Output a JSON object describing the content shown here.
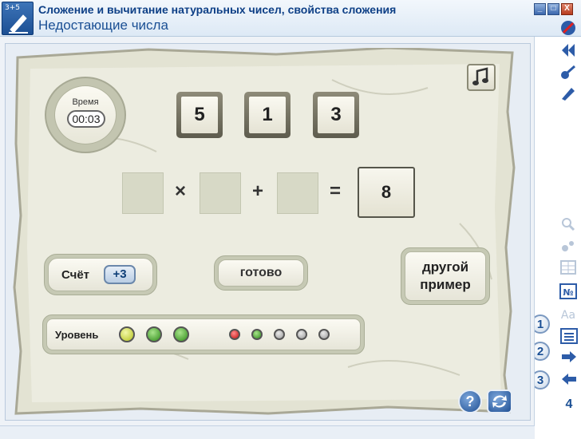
{
  "header": {
    "logo_label": "3+5",
    "topic": "Сложение и вычитание натуральных чисел, свойства сложения",
    "task": "Недостающие числа"
  },
  "window_controls": {
    "minimize": "_",
    "maximize": "□",
    "close": "X"
  },
  "toolbar": {
    "step_numbers": [
      "1",
      "2",
      "3",
      "4"
    ]
  },
  "game": {
    "timer": {
      "label": "Время",
      "value": "00:03"
    },
    "number_tiles": [
      "5",
      "1",
      "3"
    ],
    "equation": {
      "op1": "×",
      "op2": "+",
      "equals": "=",
      "result": "8"
    },
    "score": {
      "label": "Счёт",
      "value": "+3"
    },
    "done_button": "готово",
    "other_example_button": {
      "line1": "другой",
      "line2": "пример"
    },
    "level": {
      "label": "Уровень",
      "level_count": 3,
      "progress_marks": [
        "red",
        "green",
        "grey",
        "grey",
        "grey"
      ]
    }
  },
  "colors": {
    "header_text": "#0d3f86",
    "parchment": "#e2e2d3",
    "red_mark": "#d22020",
    "green_mark": "#3fa81c"
  }
}
